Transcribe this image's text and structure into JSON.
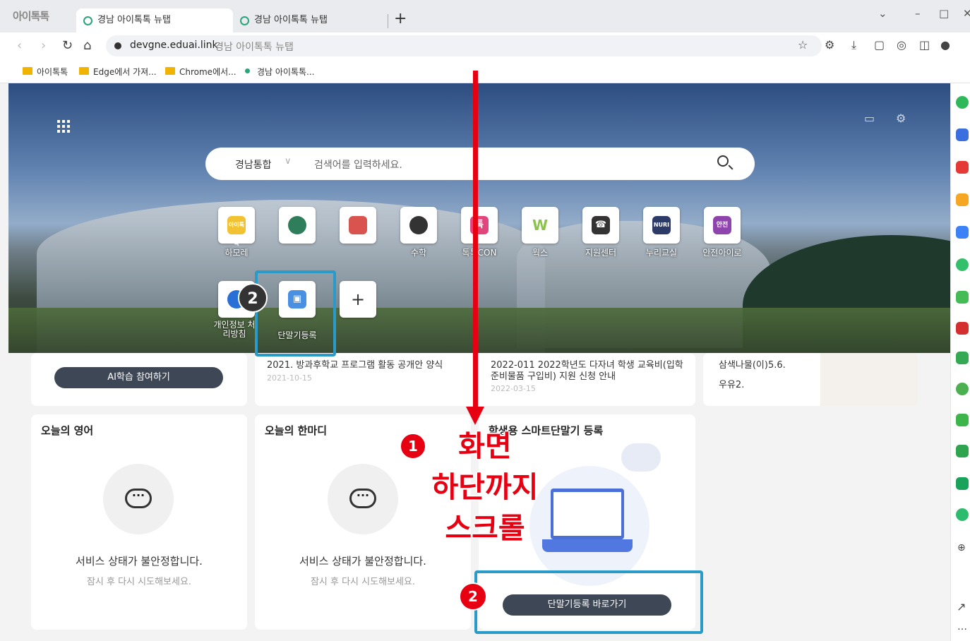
{
  "browser": {
    "logo_text": "아이톡톡",
    "tabs": [
      {
        "label": "경남 아이톡톡 뉴탭"
      },
      {
        "label": "경남 아이톡톡 뉴탭"
      }
    ],
    "new_tab": "+",
    "url_host": "devgne.eduai.link",
    "url_title": "경남 아이톡톡 뉴탭"
  },
  "bookmarks": [
    {
      "label": "아이톡톡",
      "type": "folder"
    },
    {
      "label": "Edge에서 가져...",
      "type": "folder"
    },
    {
      "label": "Chrome에서...",
      "type": "folder"
    },
    {
      "label": "경남 아이톡톡...",
      "type": "site"
    }
  ],
  "hero": {
    "search_scope": "경남통합",
    "search_placeholder": "검색어를 입력하세요.",
    "quick_links": [
      {
        "label": "하모레",
        "icon": "아이톡톡",
        "color": "#f1c232"
      },
      {
        "label": "",
        "icon": "",
        "color": "#2e7d5b"
      },
      {
        "label": "",
        "icon": "",
        "color": "#d9534f"
      },
      {
        "label": "수학",
        "icon": "",
        "color": "#333333"
      },
      {
        "label": "톡톡CON",
        "icon": "톡",
        "color": "#e0457b"
      },
      {
        "label": "웍스",
        "icon": "W",
        "color": "#8bc34a"
      },
      {
        "label": "지원센터",
        "icon": "☎",
        "color": "#333333"
      },
      {
        "label": "누리교실",
        "icon": "NURI",
        "color": "#2b3a67"
      },
      {
        "label": "안전아이로",
        "icon": "안전",
        "color": "#8e44ad"
      }
    ],
    "quick_links_row2": [
      {
        "label": "개인정보 처리방침",
        "icon": "",
        "color": "#2a6fd6"
      },
      {
        "label": "단말기등록",
        "icon": "▣",
        "color": "#4a90e2"
      }
    ],
    "add_label": "+"
  },
  "main": {
    "ai_button": "AI학습 참여하기",
    "notices": [
      {
        "title": "2021. 방과후학교 프로그램 활동 공개안 양식",
        "date": "2021-10-15"
      },
      {
        "title": "2022-011 2022학년도 다자녀 학생 교육비(입학준비물품 구입비) 지원 신청 안내",
        "date": "2022-03-15"
      }
    ],
    "meal": [
      "삼색나물(이)5.6.",
      "우유2."
    ],
    "cards": [
      {
        "title": "오늘의 영어",
        "err": "서비스 상태가 불안정합니다.",
        "retry": "잠시 후 다시 시도해보세요."
      },
      {
        "title": "오늘의 한마디",
        "err": "서비스 상태가 불안정합니다.",
        "retry": "잠시 후 다시 시도해보세요."
      }
    ],
    "device_card_title": "학생용 스마트단말기 등록",
    "device_button": "단말기등록 바로가기"
  },
  "annotation": {
    "step1_number": "1",
    "step1_text_lines": [
      "화면",
      "하단까지",
      "스크롤"
    ],
    "step2_number": "2"
  }
}
